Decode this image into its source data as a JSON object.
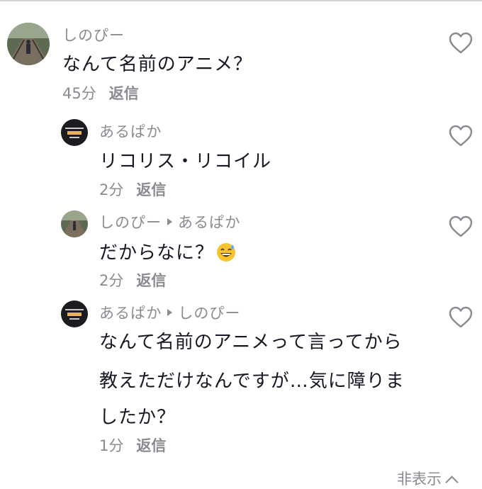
{
  "comments": [
    {
      "author": "しのぴー",
      "text": "なんて名前のアニメ？",
      "time": "45分",
      "reply_label": "返信",
      "avatar_icon": "person-on-bridge-icon"
    },
    {
      "author": "あるぱか",
      "text": "リコリス・リコイル",
      "time": "2分",
      "reply_label": "返信",
      "avatar_icon": "anime-title-logo-icon"
    },
    {
      "author": "しのぴー",
      "reply_to": "あるぱか",
      "text": "だからなに？",
      "emoji": "grinning-sweat-emoji",
      "time": "2分",
      "reply_label": "返信",
      "avatar_icon": "person-on-bridge-icon"
    },
    {
      "author": "あるぱか",
      "reply_to": "しのぴー",
      "text_lines": [
        "なんて名前のアニメって言ってから",
        "教えただけなんですが…気に障りま",
        "したか？"
      ],
      "time": "1分",
      "reply_label": "返信",
      "avatar_icon": "anime-title-logo-icon"
    }
  ],
  "hide_label": "非表示",
  "colors": {
    "text": "#161823",
    "muted": "#8a8b91",
    "heart": "#8a8b91"
  }
}
